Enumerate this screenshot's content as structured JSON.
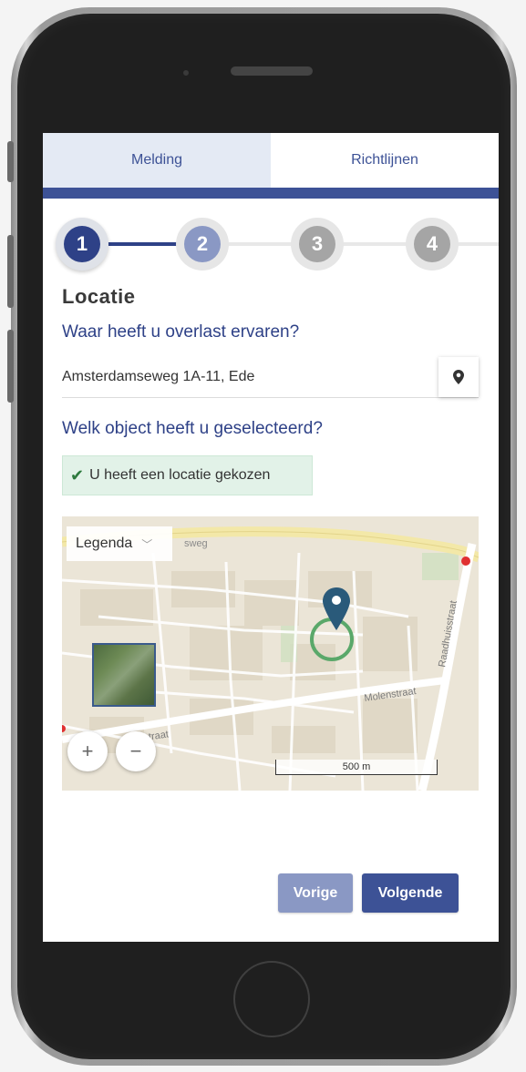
{
  "tabs": [
    {
      "label": "Melding",
      "active": true
    },
    {
      "label": "Richtlijnen",
      "active": false
    }
  ],
  "steps": [
    {
      "number": "1",
      "state": "current",
      "color": "#2e4187"
    },
    {
      "number": "2",
      "state": "upcoming",
      "color": "#8a98c4"
    },
    {
      "number": "3",
      "state": "upcoming",
      "color": "#a5a5a5"
    },
    {
      "number": "4",
      "state": "upcoming",
      "color": "#a5a5a5"
    }
  ],
  "form": {
    "section_title": "Locatie",
    "location_question": "Waar heeft u overlast ervaren?",
    "address_value": "Amsterdamseweg 1A-11, Ede",
    "object_question": "Welk object heeft u geselecteerd?",
    "selection_status": "U heeft een locatie gekozen"
  },
  "map": {
    "legend_label": "Legenda",
    "street_labels": [
      "sweg",
      "Raadhuisstraat",
      "Molenstraat",
      "nstraat"
    ],
    "scale_label": "500 m",
    "zoom_in_label": "+",
    "zoom_out_label": "−",
    "marker_color": "#2a5a7a",
    "selection_circle_color": "#5aa86a"
  },
  "navigation": {
    "previous_label": "Vorige",
    "next_label": "Volgende"
  },
  "colors": {
    "accent": "#3d5296",
    "accent_light": "#8a98c4",
    "success_bg": "#e2f2e8"
  },
  "icons": [
    "map-pin-icon",
    "checkmark-icon",
    "chevron-down-icon",
    "map-marker-icon"
  ]
}
